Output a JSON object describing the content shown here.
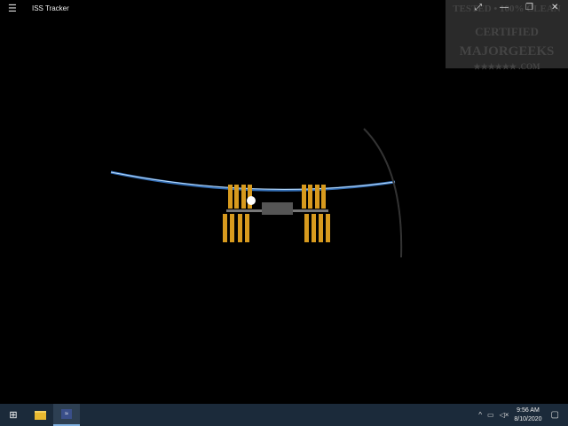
{
  "window": {
    "title": "ISS Tracker",
    "menu_icon": "hamburger-icon"
  },
  "watermark": {
    "lines": [
      "TESTED • 100% CLEAN",
      "CERTIFIED",
      "MAJORGEEKS",
      "★★★★★★ .COM"
    ]
  },
  "controls": {
    "fullscreen": "⤢",
    "minimize": "—",
    "restore": "❐",
    "close": "✕"
  },
  "taskbar": {
    "time": "9:56 AM",
    "date": "8/10/2020"
  }
}
